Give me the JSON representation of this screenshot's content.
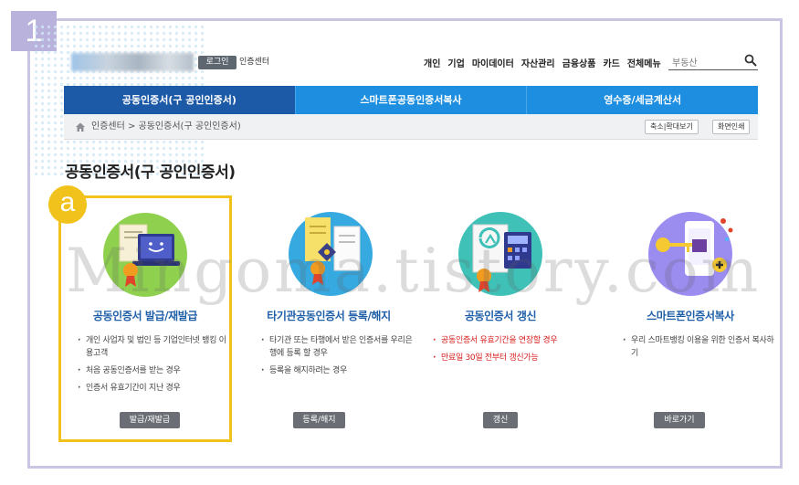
{
  "step_badge": "1",
  "header": {
    "login_label": "로그인",
    "cert_center_label": "인증센터",
    "top_nav": [
      "개인",
      "기업",
      "마이데이터",
      "자산관리",
      "금융상품",
      "카드",
      "전체메뉴"
    ],
    "search": {
      "value": "부동산"
    }
  },
  "tabs": [
    {
      "label": "공동인증서(구 공인인증서)",
      "active": true
    },
    {
      "label": "스마트폰공동인증서복사",
      "active": false
    },
    {
      "label": "영수증/세금계산서",
      "active": false
    }
  ],
  "breadcrumb": {
    "text": "인증센터 > 공동인증서(구 공인인증서)",
    "zoom_label": "축소|확대보기",
    "print_label": "화면인쇄"
  },
  "page_title": "공동인증서(구 공인인증서)",
  "highlight_badge": "a",
  "cards": [
    {
      "title": "공동인증서 발급/재발급",
      "bullets": [
        {
          "text": "개인 사업자 및 법인 등 기업인터넷 뱅킹 이용고객",
          "red": false
        },
        {
          "text": "처음 공동인증서를 받는 경우",
          "red": false
        },
        {
          "text": "인증서 유효기간이 지난 경우",
          "red": false
        }
      ],
      "button": "발급/재발급"
    },
    {
      "title": "타기관공동인증서 등록/해지",
      "bullets": [
        {
          "text": "타기관 또는 타행에서 받은 인증서를 우리은행에 등록 할 경우",
          "red": false
        },
        {
          "text": "등록을 해지하려는 경우",
          "red": false
        }
      ],
      "button": "등록/해지"
    },
    {
      "title": "공동인증서 갱신",
      "bullets": [
        {
          "text": "공동인증서 유효기간을 연장할 경우",
          "red": true
        },
        {
          "text": "만료일 30일 전부터 갱신가능",
          "red": true
        }
      ],
      "button": "갱신"
    },
    {
      "title": "스마트폰인증서복사",
      "bullets": [
        {
          "text": "우리 스마트뱅킹 이용을 위한 인증서 복사하기",
          "red": false
        }
      ],
      "button": "바로가기"
    }
  ],
  "watermark": "Mingoma.tistory.com",
  "colors": {
    "tab_blue": "#1d8ee0",
    "tab_active": "#1c5aa8",
    "highlight": "#f1c21b",
    "frame": "#c9c5e3",
    "badge": "#b9b2dc",
    "red_text": "#d81e1e"
  }
}
